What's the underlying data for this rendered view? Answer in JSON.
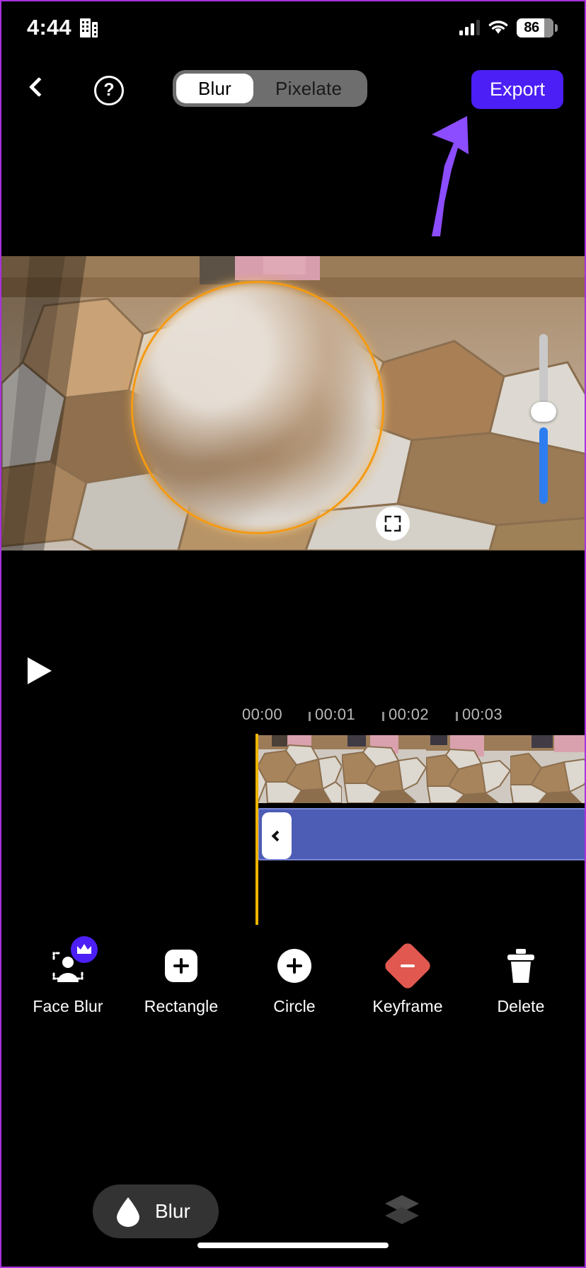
{
  "status_bar": {
    "time": "4:44",
    "app_icon": "building-icon",
    "signal_icon": "cellular-signal-icon",
    "wifi_icon": "wifi-icon",
    "battery_level": "86"
  },
  "toolbar": {
    "back_icon": "chevron-left-icon",
    "help_label": "?",
    "help_icon": "question-mark-circle-icon",
    "modes": [
      {
        "label": "Blur",
        "active": true
      },
      {
        "label": "Pixelate",
        "active": false
      }
    ],
    "export_label": "Export",
    "export_color": "#4b1ff5"
  },
  "annotation": {
    "arrow_icon": "arrow-up-right-icon",
    "arrow_color": "#8b4dff",
    "points_to": "Export"
  },
  "preview": {
    "mask_shape": "circle",
    "mask_outline_color": "#f59a11",
    "expand_icon": "expand-corners-icon",
    "slider": {
      "name": "blur-intensity-slider",
      "filled_color": "#2d7df0",
      "track_color": "#c9c9c9"
    }
  },
  "player": {
    "play_icon": "play-icon"
  },
  "timeline": {
    "ruler_labels": [
      "00:00",
      "00:01",
      "00:02",
      "00:03"
    ],
    "playhead_color": "#f0b400",
    "effect_track": {
      "name": "blur-effect-clip",
      "color": "#4d5cb5",
      "handle_icon": "chevron-left-icon"
    }
  },
  "tools": [
    {
      "label": "Face Blur",
      "icon": "face-blur-icon",
      "badge": "crown-icon",
      "premium": true
    },
    {
      "label": "Rectangle",
      "icon": "rectangle-plus-icon",
      "premium": false
    },
    {
      "label": "Circle",
      "icon": "circle-plus-icon",
      "premium": false
    },
    {
      "label": "Keyframe",
      "icon": "keyframe-diamond-minus-icon",
      "premium": false
    },
    {
      "label": "Delete",
      "icon": "trash-icon",
      "premium": false
    }
  ],
  "bottom_bar": {
    "effect_label": "Blur",
    "effect_icon": "water-drop-icon",
    "layers_icon": "layers-icon"
  }
}
